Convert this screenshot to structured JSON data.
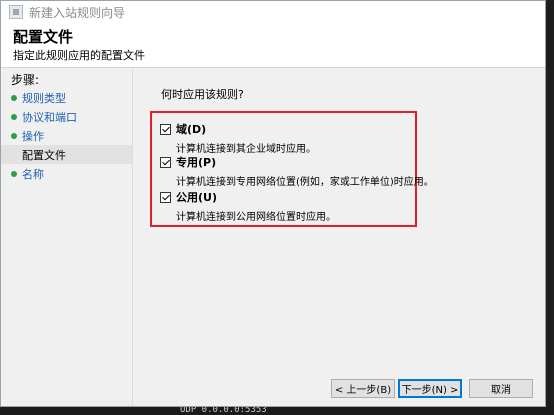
{
  "window": {
    "title": "新建入站规则向导",
    "header_title": "配置文件",
    "header_subtitle": "指定此规则应用的配置文件"
  },
  "sidebar": {
    "steps_label": "步骤:",
    "items": [
      {
        "label": "规则类型"
      },
      {
        "label": "协议和端口"
      },
      {
        "label": "操作"
      },
      {
        "label": "配置文件"
      },
      {
        "label": "名称"
      }
    ]
  },
  "content": {
    "question": "何时应用该规则?",
    "options": [
      {
        "label": "域(D)",
        "description": "计算机连接到其企业域时应用。",
        "checked": true
      },
      {
        "label": "专用(P)",
        "description": "计算机连接到专用网络位置(例如，家或工作单位)时应用。",
        "checked": true
      },
      {
        "label": "公用(U)",
        "description": "计算机连接到公用网络位置时应用。",
        "checked": true
      }
    ]
  },
  "buttons": {
    "back": "< 上一步(B)",
    "next": "下一步(N) >",
    "cancel": "取消"
  },
  "background": {
    "bottom_text": "UDP   0.0.0.0:5353"
  },
  "colors": {
    "highlight_border": "#e0202a",
    "link_text": "#1f5fb4",
    "step_dot": "#2d9d4a",
    "primary_button_border": "#0078d7"
  }
}
